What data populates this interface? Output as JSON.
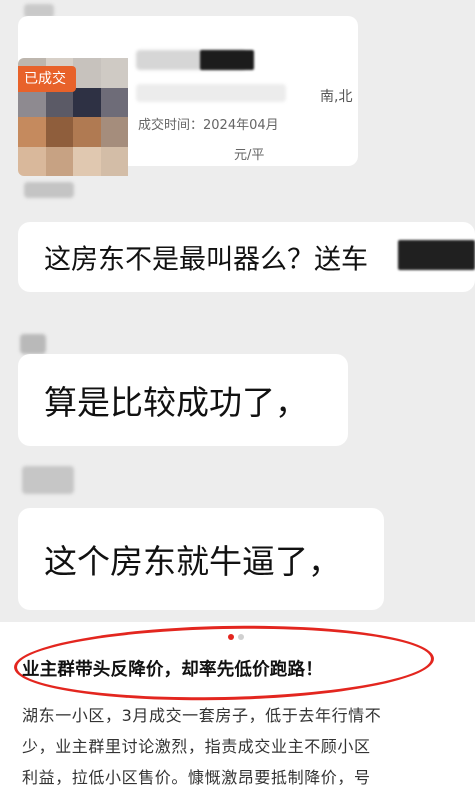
{
  "card": {
    "deal_tag": "已成交",
    "deal_time": "成交时间：2024年04月",
    "direction": "南,北",
    "unit_price": "元/平",
    "tag_color": "#e8622a"
  },
  "messages": [
    {
      "text": "这房东不是最叫器么？送车"
    },
    {
      "text": "算是比较成功了，"
    },
    {
      "text": "这个房东就牛逼了，"
    }
  ],
  "article": {
    "headline": "业主群带头反降价，却率先低价跑路！",
    "body_lines": [
      "湖东一小区，3月成交一套房子，低于去年行情不",
      "少，业主群里讨论激烈，指责成交业主不顾小区",
      "利益，拉低小区售价。慷慨激昂要抵制降价，号"
    ],
    "annotation_color": "#e3261f"
  },
  "carousel": {
    "active_index": 0,
    "count": 2
  }
}
